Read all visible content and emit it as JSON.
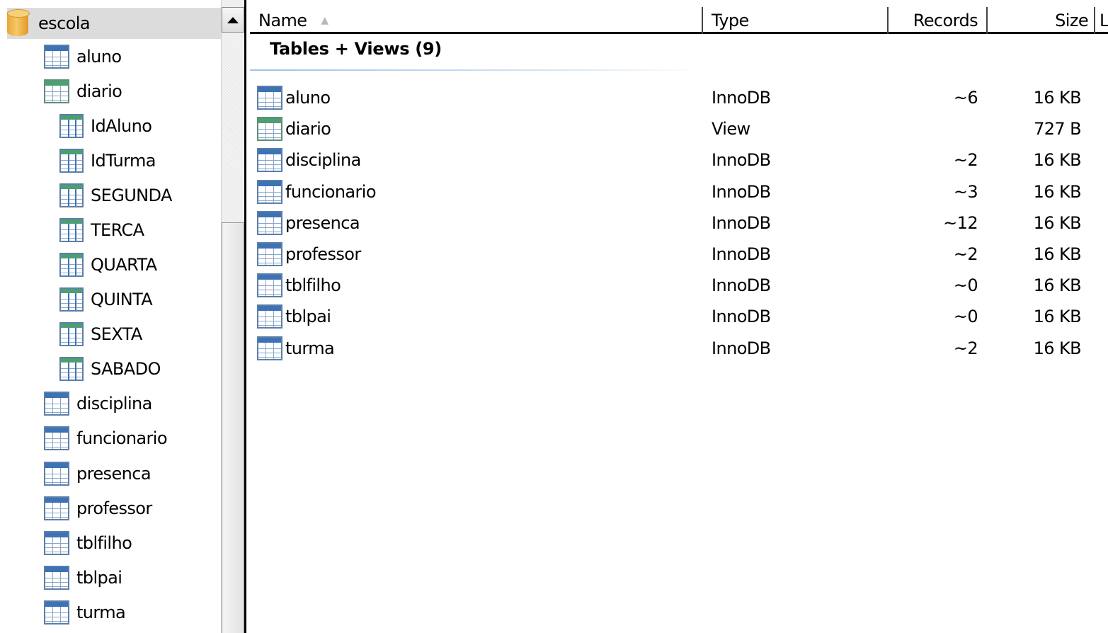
{
  "tree": {
    "database": "escola",
    "items": [
      {
        "label": "aluno",
        "icon": "table-icon",
        "level": 1
      },
      {
        "label": "diario",
        "icon": "view-icon",
        "level": 1
      },
      {
        "label": "IdAluno",
        "icon": "column-icon",
        "level": 2
      },
      {
        "label": "IdTurma",
        "icon": "column-icon",
        "level": 2
      },
      {
        "label": "SEGUNDA",
        "icon": "column-icon",
        "level": 2
      },
      {
        "label": "TERCA",
        "icon": "column-icon",
        "level": 2
      },
      {
        "label": "QUARTA",
        "icon": "column-icon",
        "level": 2
      },
      {
        "label": "QUINTA",
        "icon": "column-icon",
        "level": 2
      },
      {
        "label": "SEXTA",
        "icon": "column-icon",
        "level": 2
      },
      {
        "label": "SABADO",
        "icon": "column-icon",
        "level": 2
      },
      {
        "label": "disciplina",
        "icon": "table-icon",
        "level": 1
      },
      {
        "label": "funcionario",
        "icon": "table-icon",
        "level": 1
      },
      {
        "label": "presenca",
        "icon": "table-icon",
        "level": 1
      },
      {
        "label": "professor",
        "icon": "table-icon",
        "level": 1
      },
      {
        "label": "tblfilho",
        "icon": "table-icon",
        "level": 1
      },
      {
        "label": "tblpai",
        "icon": "table-icon",
        "level": 1
      },
      {
        "label": "turma",
        "icon": "table-icon",
        "level": 1
      }
    ]
  },
  "list": {
    "columns": {
      "name": "Name",
      "type": "Type",
      "records": "Records",
      "size": "Size",
      "more": "L"
    },
    "sort_icon": "sort-ascending-icon",
    "group_title": "Tables + Views (9)",
    "rows": [
      {
        "name": "aluno",
        "type": "InnoDB",
        "records": "~6",
        "size": "16 KB",
        "icon": "table-icon"
      },
      {
        "name": "diario",
        "type": "View",
        "records": "",
        "size": "727 B",
        "icon": "view-icon"
      },
      {
        "name": "disciplina",
        "type": "InnoDB",
        "records": "~2",
        "size": "16 KB",
        "icon": "table-icon"
      },
      {
        "name": "funcionario",
        "type": "InnoDB",
        "records": "~3",
        "size": "16 KB",
        "icon": "table-icon"
      },
      {
        "name": "presenca",
        "type": "InnoDB",
        "records": "~12",
        "size": "16 KB",
        "icon": "table-icon"
      },
      {
        "name": "professor",
        "type": "InnoDB",
        "records": "~2",
        "size": "16 KB",
        "icon": "table-icon"
      },
      {
        "name": "tblfilho",
        "type": "InnoDB",
        "records": "~0",
        "size": "16 KB",
        "icon": "table-icon"
      },
      {
        "name": "tblpai",
        "type": "InnoDB",
        "records": "~0",
        "size": "16 KB",
        "icon": "table-icon"
      },
      {
        "name": "turma",
        "type": "InnoDB",
        "records": "~2",
        "size": "16 KB",
        "icon": "table-icon"
      }
    ]
  },
  "colors": {
    "selected_row_bg": "#dcdcdc",
    "table_icon_header": "#3d73b5",
    "view_icon_header": "#4e9e74",
    "database_icon": "#f6c867"
  }
}
